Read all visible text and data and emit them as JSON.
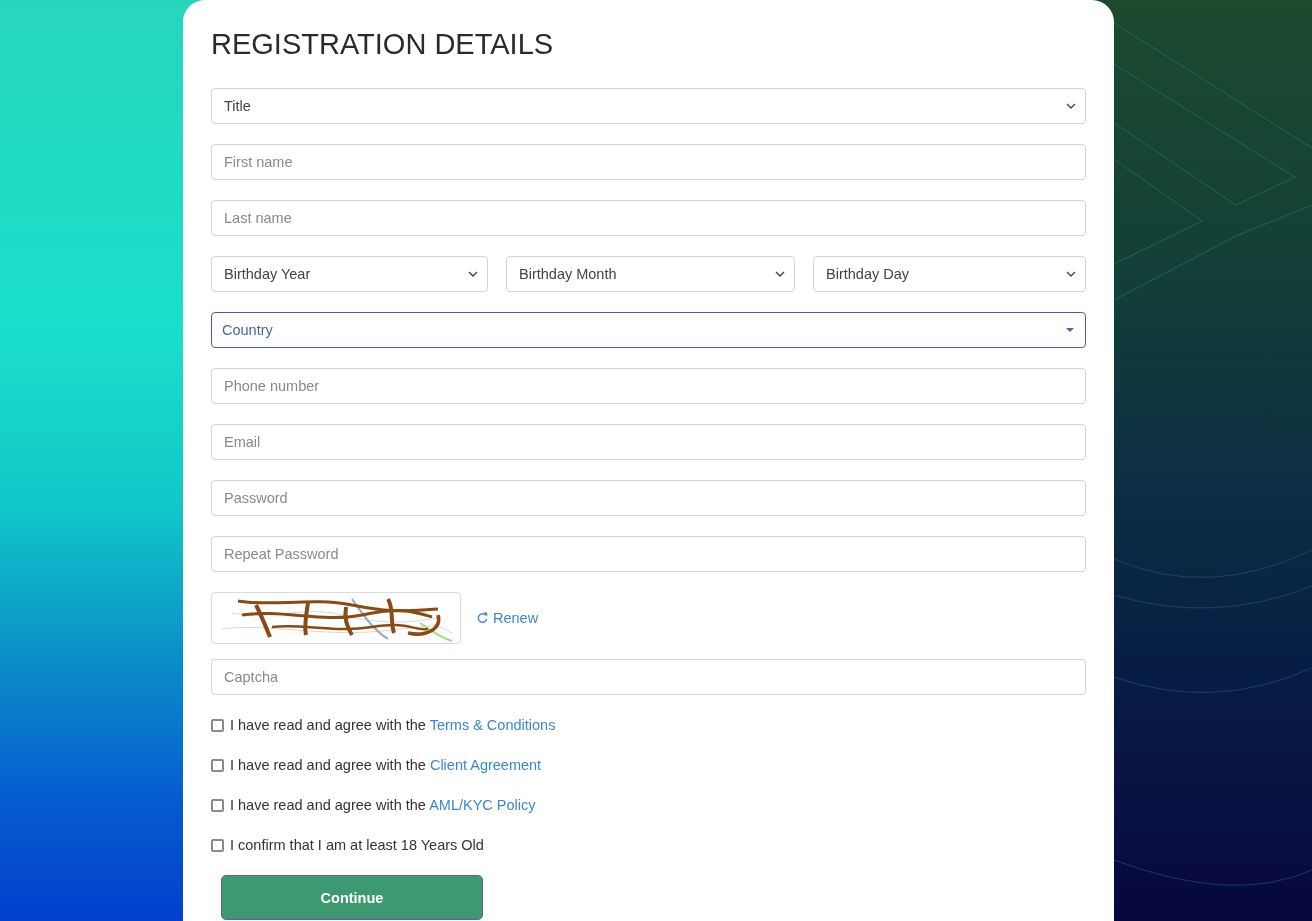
{
  "heading": "REGISTRATION DETAILS",
  "fields": [
    {
      "kind": "select",
      "value": "Title"
    },
    {
      "kind": "input",
      "placeholder": "First name"
    },
    {
      "kind": "input",
      "placeholder": "Last name"
    },
    {
      "kind": "select_group",
      "selects": [
        {
          "value": "Birthday Year"
        },
        {
          "value": "Birthday Month"
        },
        {
          "value": "Birthday Day"
        }
      ]
    },
    {
      "kind": "combo",
      "value": "Country",
      "focused": true
    },
    {
      "kind": "input",
      "placeholder": "Phone number"
    },
    {
      "kind": "input",
      "placeholder": "Email"
    },
    {
      "kind": "input",
      "placeholder": "Password"
    },
    {
      "kind": "input",
      "placeholder": "Repeat Password"
    },
    {
      "kind": "captcha",
      "renew": "Renew"
    },
    {
      "kind": "input",
      "placeholder": "Captcha"
    }
  ],
  "agreements": [
    {
      "text": "I have read and agree with the",
      "link": "Terms & Conditions",
      "checked": false
    },
    {
      "text": "I have read and agree with the",
      "link": "Client Agreement",
      "checked": false
    },
    {
      "text": "I have read and agree with the",
      "link": "AML/KYC Policy",
      "checked": false
    },
    {
      "text": "I confirm that I am at least 18 Years Old",
      "checked": false
    }
  ],
  "continue_button": "Continue"
}
